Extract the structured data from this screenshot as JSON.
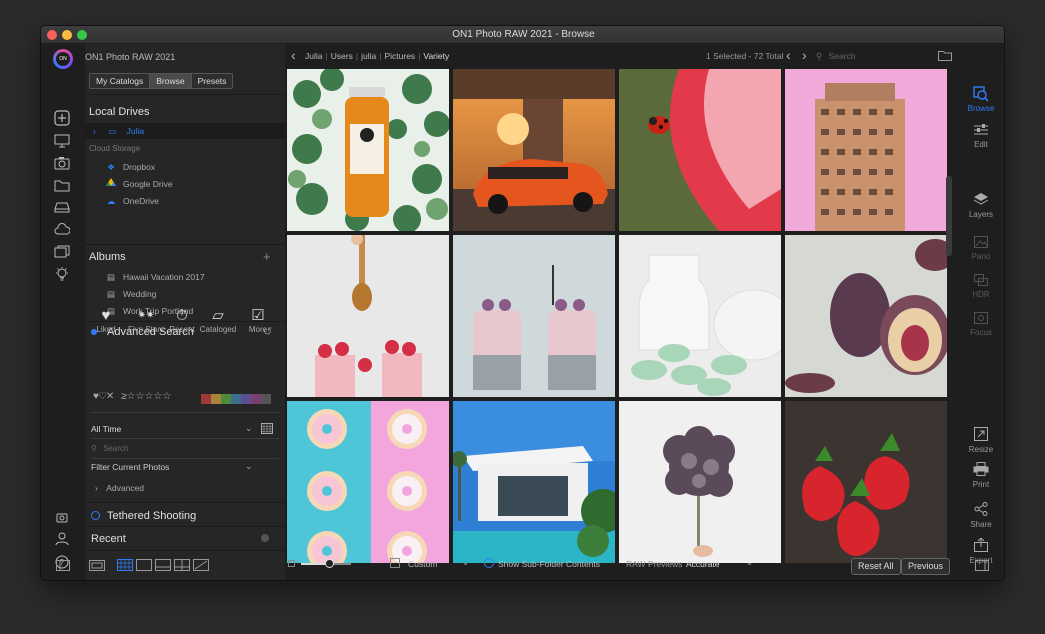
{
  "window": {
    "title": "ON1 Photo RAW 2021 - Browse"
  },
  "app": {
    "name": "ON1 Photo RAW 2021",
    "logo_text": "ON"
  },
  "panel": {
    "tabs": [
      "My Catalogs",
      "Browse",
      "Presets"
    ],
    "active_tab": "Browse",
    "local_drives_title": "Local Drives",
    "local_drives": [
      "Julia"
    ],
    "cloud_storage_title": "Cloud Storage",
    "cloud": [
      "Dropbox",
      "Google Drive",
      "OneDrive"
    ],
    "albums_title": "Albums",
    "albums": [
      "Hawaii Vacation 2017",
      "Wedding",
      "Work Trip Portland"
    ],
    "advanced_search_title": "Advanced Search",
    "filters": [
      {
        "label": "Liked",
        "icon": "heart-icon"
      },
      {
        "label": "Five Stars",
        "icon": "stars-icon"
      },
      {
        "label": "Recent",
        "icon": "stopwatch-icon"
      },
      {
        "label": "Cataloged",
        "icon": "folder-heart-icon"
      },
      {
        "label": "More",
        "icon": "checkbox-chevron-icon"
      }
    ],
    "date_range": "All Time",
    "search_placeholder": "Search",
    "filter_current": "Filter Current Photos",
    "advanced_label": "Advanced",
    "tethered_title": "Tethered Shooting",
    "recent_title": "Recent"
  },
  "topbar": {
    "breadcrumb": [
      "Julia",
      "Users",
      "julia",
      "Pictures",
      "Variety"
    ],
    "selection": "1 Selected - 72 Total",
    "search_placeholder": "Search"
  },
  "bottombar": {
    "grid_label": "Custom",
    "show_subfolder": "Show Sub-Folder Contents",
    "raw_previews_label": "RAW Previews",
    "raw_previews_value": "Accurate",
    "reset_all": "Reset All",
    "previous": "Previous"
  },
  "right_modules": [
    {
      "label": "Browse",
      "icon": "browse-icon",
      "active": true
    },
    {
      "label": "Edit",
      "icon": "sliders-icon",
      "active": false
    },
    {
      "label": "Layers",
      "icon": "layers-icon",
      "active": false
    },
    {
      "label": "Pano",
      "icon": "pano-icon",
      "active": false
    },
    {
      "label": "HDR",
      "icon": "hdr-icon",
      "active": false
    },
    {
      "label": "Focus",
      "icon": "focus-icon",
      "active": false
    },
    {
      "label": "Resize",
      "icon": "resize-icon",
      "active": false
    },
    {
      "label": "Print",
      "icon": "print-icon",
      "active": false
    },
    {
      "label": "Share",
      "icon": "share-icon",
      "active": false
    },
    {
      "label": "Export",
      "icon": "export-icon",
      "active": false
    }
  ],
  "photos": [
    "Juice bottle on green leaves",
    "Orange car at sunset",
    "Ladybug on red petal",
    "Brick tower building",
    "Honey dipper over raspberries",
    "Chia pudding jars",
    "Macarons and white jug",
    "Sliced figs",
    "Donuts on blue and pink",
    "White modern house",
    "Dried carnation flower",
    "Strawberries"
  ],
  "colors": {
    "accent": "#2f7cf6",
    "window_bg": "#1e1e1e",
    "panel_bg": "#262626",
    "label_swatches": [
      "#9c3a3a",
      "#a8843a",
      "#4e8a3c",
      "#3a6f8f",
      "#5c4f8f",
      "#7a3f6e"
    ]
  }
}
